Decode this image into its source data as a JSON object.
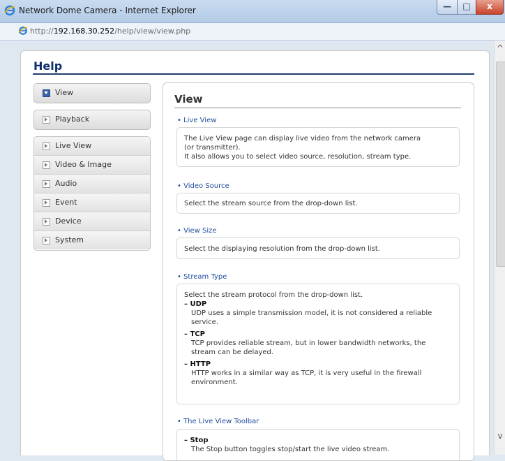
{
  "window": {
    "title": "Network Dome Camera - Internet Explorer",
    "close_glyph": "x",
    "minimize_glyph": "—",
    "maximize_glyph": "□"
  },
  "address": {
    "url_prefix": "http://",
    "url_host": "192.168.30.252",
    "url_path": "/help/view/view.php"
  },
  "page": {
    "title": "Help"
  },
  "nav": {
    "view": "View",
    "playback": "Playback",
    "items": [
      "Live View",
      "Video & Image",
      "Audio",
      "Event",
      "Device",
      "System"
    ]
  },
  "content": {
    "title": "View",
    "sections": {
      "live_view": {
        "heading": "• Live View",
        "line1": "The Live View page can display live video from the network camera",
        "line2": "(or transmitter).",
        "line3": "It also allows you to select video source, resolution, stream type."
      },
      "video_source": {
        "heading": "• Video Source",
        "text": "Select the stream source from the drop-down list."
      },
      "view_size": {
        "heading": "• View Size",
        "text": "Select the displaying resolution from the drop-down list."
      },
      "stream_type": {
        "heading": "• Stream Type",
        "intro": "Select the stream protocol from the drop-down list.",
        "udp_label": "– UDP",
        "udp_l1": "UDP uses a simple transmission model, it is not considered a reliable",
        "udp_l2": "service.",
        "tcp_label": "– TCP",
        "tcp_l1": "TCP provides reliable stream, but in lower bandwidth networks, the",
        "tcp_l2": "stream can be delayed.",
        "http_label": "– HTTP",
        "http_l1": "HTTP works in a similar way as TCP, it is very useful in the firewall",
        "http_l2": "environment."
      },
      "toolbar": {
        "heading": "• The Live View Toolbar",
        "stop_label": "– Stop",
        "stop_text": "The Stop button toggles stop/start the live video stream."
      }
    }
  },
  "scrollbar": {
    "up_glyph": "^",
    "down_glyph": "v"
  }
}
